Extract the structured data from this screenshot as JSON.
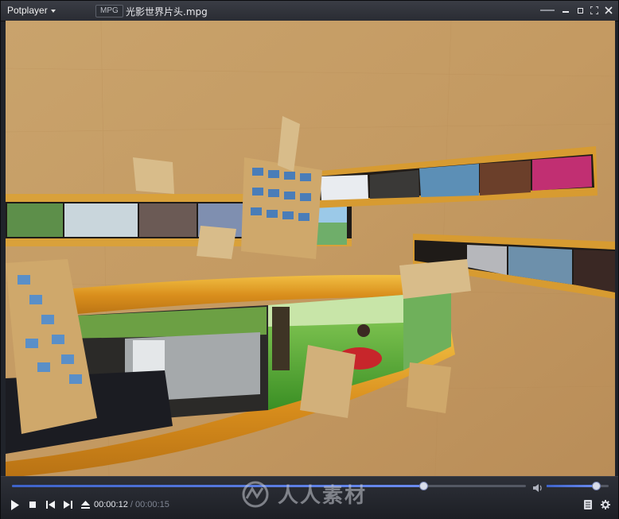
{
  "titlebar": {
    "app_name": "Potplayer",
    "format_badge": "MPG",
    "file_name": "光影世界片头.mpg"
  },
  "playback": {
    "current_time": "00:00:12",
    "separator": "/",
    "total_time": "00:00:15",
    "progress_fraction": 0.8,
    "volume_fraction": 0.8
  },
  "watermark": {
    "text": "人人素材"
  },
  "icons": {
    "menu": "chevron-down-icon",
    "window": [
      "minimize-icon",
      "maximize-icon",
      "fullscreen-icon",
      "close-icon"
    ],
    "playback": [
      "play-icon",
      "stop-icon",
      "previous-icon",
      "next-icon",
      "eject-icon"
    ],
    "right": [
      "playlist-icon",
      "settings-icon"
    ],
    "volume": "speaker-icon"
  },
  "colors": {
    "accent": "#4a6fd6",
    "paper_background": "#c7a16a",
    "film_strip": "#e3a22b"
  }
}
